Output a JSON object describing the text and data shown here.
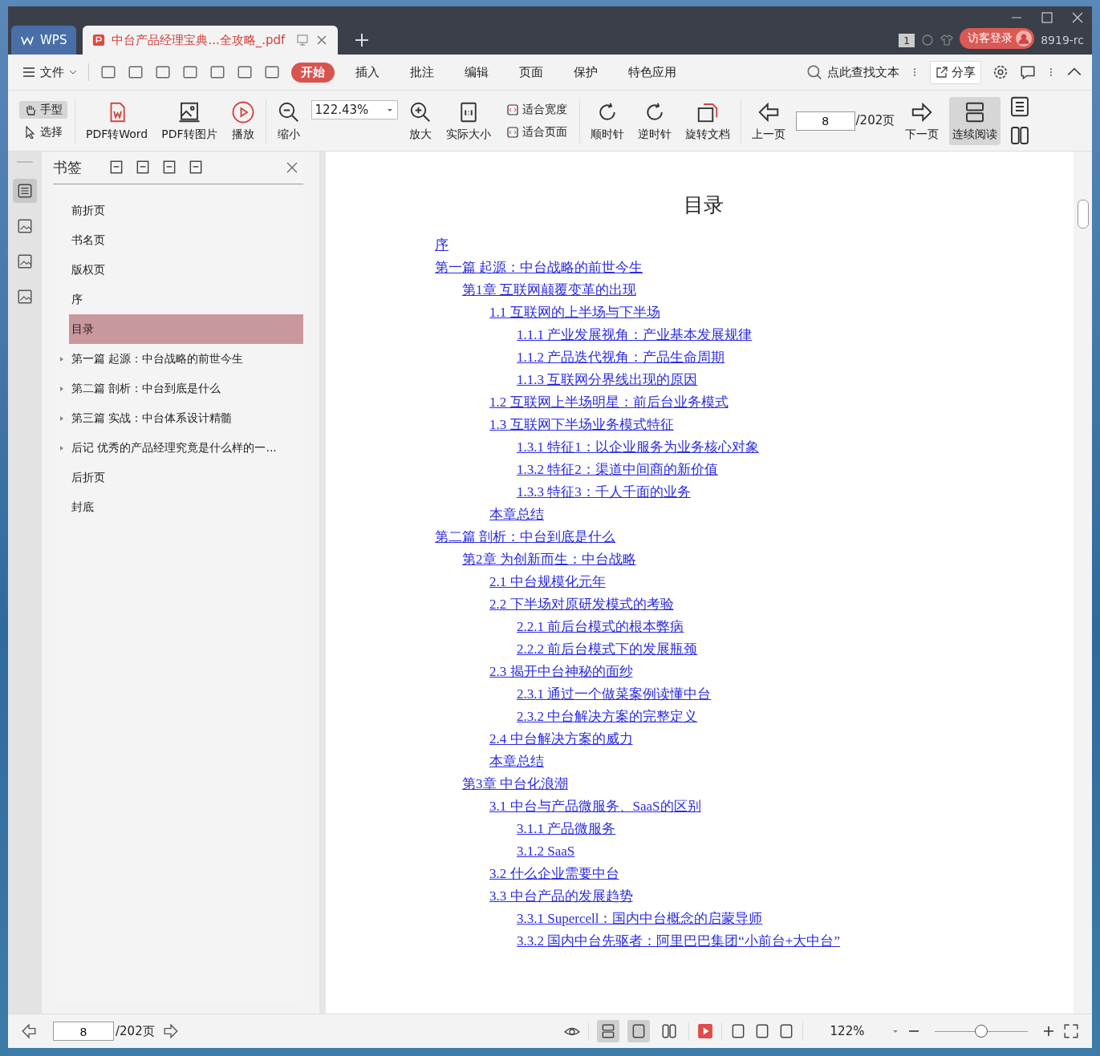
{
  "tabs": [
    {
      "label": "WPS",
      "kind": "home",
      "selected": false
    },
    {
      "label": "中台产品经理宝典...全攻略_.pdf",
      "kind": "doc",
      "selected": true
    }
  ],
  "title_bar": {
    "badge": "1",
    "login": "访客登录",
    "user": "8919-rc"
  },
  "menu": {
    "file": "文件",
    "tabs": [
      {
        "label": "开始",
        "selected": true
      },
      {
        "label": "插入",
        "selected": false
      },
      {
        "label": "批注",
        "selected": false
      },
      {
        "label": "编辑",
        "selected": false
      },
      {
        "label": "页面",
        "selected": false
      },
      {
        "label": "保护",
        "selected": false
      },
      {
        "label": "特色应用",
        "selected": false
      }
    ],
    "search": "点此查找文本",
    "share": "分享"
  },
  "toolbar": {
    "hand": {
      "label": "手型",
      "selected": true
    },
    "select": {
      "label": "选择",
      "selected": false
    },
    "buttons_a": [
      "PDF转Word",
      "PDF转图片",
      "播放",
      "缩小"
    ],
    "zoom": "122.43%",
    "buttons_b": [
      "放大",
      "实际大小"
    ],
    "fit": [
      "适合宽度",
      "适合页面"
    ],
    "buttons_c": [
      "顺时针",
      "逆时针",
      "旋转文档",
      "上一页"
    ],
    "page": "8",
    "total": "/202页",
    "next": "下一页",
    "continuous": {
      "label": "连续阅读",
      "selected": true
    }
  },
  "bookmarks": {
    "title": "书签",
    "items": [
      {
        "label": "前折页",
        "expandable": false,
        "selected": false
      },
      {
        "label": "书名页",
        "expandable": false,
        "selected": false
      },
      {
        "label": "版权页",
        "expandable": false,
        "selected": false
      },
      {
        "label": "序",
        "expandable": false,
        "selected": false
      },
      {
        "label": "目录",
        "expandable": false,
        "selected": true
      },
      {
        "label": "第一篇 起源：中台战略的前世今生",
        "expandable": true,
        "selected": false
      },
      {
        "label": "第二篇 剖析：中台到底是什么",
        "expandable": true,
        "selected": false
      },
      {
        "label": "第三篇 实战：中台体系设计精髓",
        "expandable": true,
        "selected": false
      },
      {
        "label": "后记 优秀的产品经理究竟是什么样的一...",
        "expandable": true,
        "selected": false
      },
      {
        "label": "后折页",
        "expandable": false,
        "selected": false
      },
      {
        "label": "封底",
        "expandable": false,
        "selected": false
      }
    ]
  },
  "page": {
    "heading": "目录",
    "toc": [
      {
        "label": "序"
      },
      {
        "label": "第一篇 起源：中台战略的前世今生",
        "children": [
          {
            "label": "第1章 互联网颠覆变革的出现",
            "children": [
              {
                "label": "1.1 互联网的上半场与下半场",
                "children": [
                  {
                    "label": "1.1.1 产业发展视角：产业基本发展规律"
                  },
                  {
                    "label": "1.1.2 产品迭代视角：产品生命周期"
                  },
                  {
                    "label": "1.1.3 互联网分界线出现的原因"
                  }
                ]
              },
              {
                "label": "1.2 互联网上半场明星：前后台业务模式"
              },
              {
                "label": "1.3 互联网下半场业务模式特征",
                "children": [
                  {
                    "label": "1.3.1 特征1：以企业服务为业务核心对象"
                  },
                  {
                    "label": "1.3.2 特征2：渠道中间商的新价值"
                  },
                  {
                    "label": "1.3.3 特征3：千人千面的业务"
                  }
                ]
              },
              {
                "label": "本章总结"
              }
            ]
          }
        ]
      },
      {
        "label": "第二篇 剖析：中台到底是什么",
        "children": [
          {
            "label": "第2章 为创新而生：中台战略",
            "children": [
              {
                "label": "2.1 中台规模化元年"
              },
              {
                "label": "2.2 下半场对原研发模式的考验",
                "children": [
                  {
                    "label": "2.2.1 前后台模式的根本弊病"
                  },
                  {
                    "label": "2.2.2 前后台模式下的发展瓶颈"
                  }
                ]
              },
              {
                "label": "2.3 揭开中台神秘的面纱",
                "children": [
                  {
                    "label": "2.3.1 通过一个做菜案例读懂中台"
                  },
                  {
                    "label": "2.3.2 中台解决方案的完整定义"
                  }
                ]
              },
              {
                "label": "2.4 中台解决方案的威力"
              },
              {
                "label": "本章总结"
              }
            ]
          },
          {
            "label": "第3章 中台化浪潮",
            "children": [
              {
                "label": "3.1 中台与产品微服务、SaaS的区别",
                "children": [
                  {
                    "label": "3.1.1 产品微服务"
                  },
                  {
                    "label": "3.1.2 SaaS"
                  }
                ]
              },
              {
                "label": "3.2 什么企业需要中台"
              },
              {
                "label": "3.3 中台产品的发展趋势",
                "children": [
                  {
                    "label": "3.3.1 Supercell：国内中台概念的启蒙导师"
                  },
                  {
                    "label": "3.3.2 国内中台先驱者：阿里巴巴集团“小前台+大中台”"
                  }
                ]
              }
            ]
          }
        ]
      }
    ]
  },
  "status_bar": {
    "page": "8",
    "total": "/202页",
    "zoom": "122%",
    "level": 0.5
  }
}
